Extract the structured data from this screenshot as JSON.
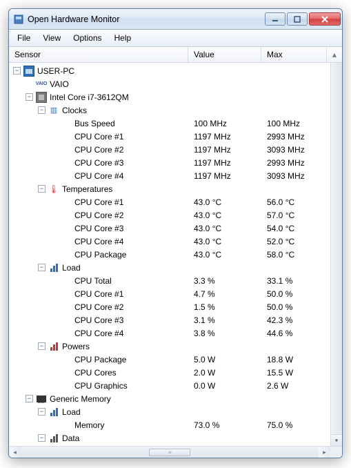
{
  "window": {
    "title": "Open Hardware Monitor"
  },
  "menu": {
    "file": "File",
    "view": "View",
    "options": "Options",
    "help": "Help"
  },
  "columns": {
    "sensor": "Sensor",
    "value": "Value",
    "max": "Max"
  },
  "tree": {
    "root": {
      "label": "USER-PC"
    },
    "vaio": {
      "label": "VAIO"
    },
    "cpu": {
      "label": "Intel Core i7-3612QM"
    },
    "clocks": {
      "label": "Clocks",
      "rows": [
        {
          "label": "Bus Speed",
          "value": "100 MHz",
          "max": "100 MHz"
        },
        {
          "label": "CPU Core #1",
          "value": "1197 MHz",
          "max": "2993 MHz"
        },
        {
          "label": "CPU Core #2",
          "value": "1197 MHz",
          "max": "3093 MHz"
        },
        {
          "label": "CPU Core #3",
          "value": "1197 MHz",
          "max": "2993 MHz"
        },
        {
          "label": "CPU Core #4",
          "value": "1197 MHz",
          "max": "3093 MHz"
        }
      ]
    },
    "temps": {
      "label": "Temperatures",
      "rows": [
        {
          "label": "CPU Core #1",
          "value": "43.0 °C",
          "max": "56.0 °C"
        },
        {
          "label": "CPU Core #2",
          "value": "43.0 °C",
          "max": "57.0 °C"
        },
        {
          "label": "CPU Core #3",
          "value": "43.0 °C",
          "max": "54.0 °C"
        },
        {
          "label": "CPU Core #4",
          "value": "43.0 °C",
          "max": "52.0 °C"
        },
        {
          "label": "CPU Package",
          "value": "43.0 °C",
          "max": "58.0 °C"
        }
      ]
    },
    "load": {
      "label": "Load",
      "rows": [
        {
          "label": "CPU Total",
          "value": "3.3 %",
          "max": "33.1 %"
        },
        {
          "label": "CPU Core #1",
          "value": "4.7 %",
          "max": "50.0 %"
        },
        {
          "label": "CPU Core #2",
          "value": "1.5 %",
          "max": "50.0 %"
        },
        {
          "label": "CPU Core #3",
          "value": "3.1 %",
          "max": "42.3 %"
        },
        {
          "label": "CPU Core #4",
          "value": "3.8 %",
          "max": "44.6 %"
        }
      ]
    },
    "powers": {
      "label": "Powers",
      "rows": [
        {
          "label": "CPU Package",
          "value": "5.0 W",
          "max": "18.8 W"
        },
        {
          "label": "CPU Cores",
          "value": "2.0 W",
          "max": "15.5 W"
        },
        {
          "label": "CPU Graphics",
          "value": "0.0 W",
          "max": "2.6 W"
        }
      ]
    },
    "memory": {
      "label": "Generic Memory"
    },
    "memload": {
      "label": "Load",
      "rows": [
        {
          "label": "Memory",
          "value": "73.0 %",
          "max": "75.0 %"
        }
      ]
    },
    "memdata": {
      "label": "Data"
    }
  }
}
